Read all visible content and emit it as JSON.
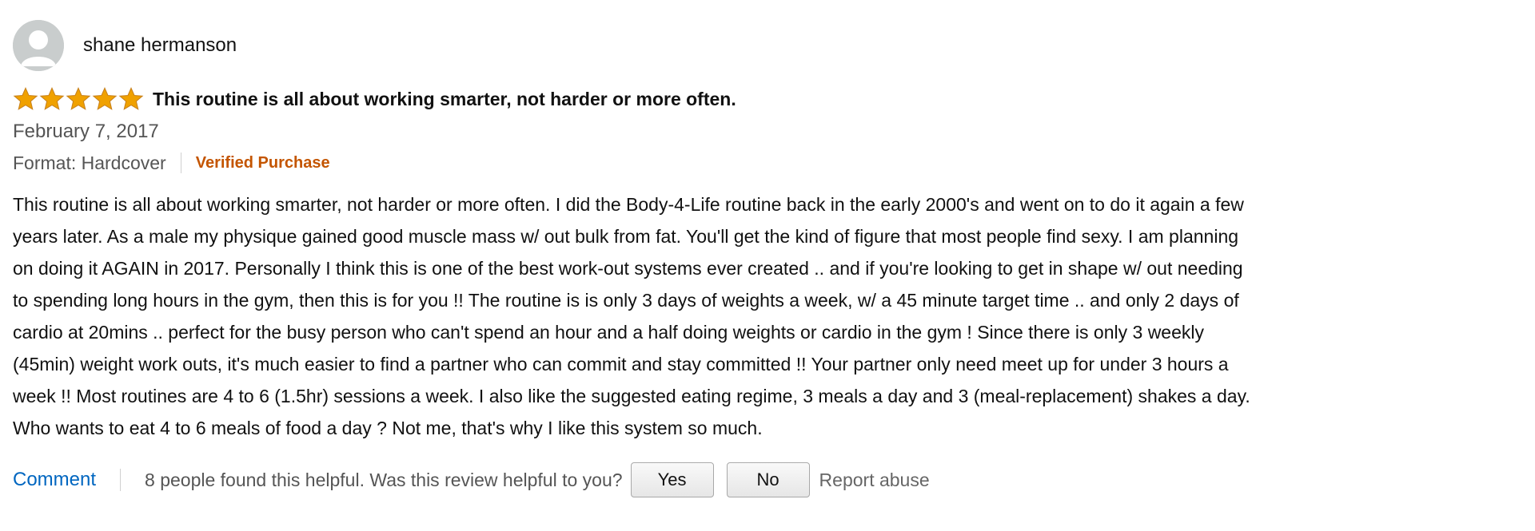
{
  "reviewer": {
    "name": "shane hermanson",
    "avatar_icon": "default-user-avatar-icon"
  },
  "rating": {
    "stars": 5,
    "max_stars": 5,
    "star_color": "#f0a100"
  },
  "review": {
    "title": "This routine is all about working smarter, not harder or more often.",
    "date": "February 7, 2017",
    "format": "Format: Hardcover",
    "verified": "Verified Purchase",
    "body_lines": [
      "This routine is all about working smarter, not harder or more often. I did the Body-4-Life routine back in the early 2000's and went on to do it again a few",
      "years later. As a male my physique gained good muscle mass w/ out bulk from fat. You'll get the kind of figure that most people find sexy. I am planning",
      "on doing it AGAIN in 2017. Personally I think this is one of the best work-out systems ever created .. and if you're looking to get in shape w/ out needing",
      "to spending long hours in the gym, then this is for you !! The routine is is only 3 days of weights a week, w/ a 45 minute target time .. and only 2 days of",
      "cardio at 20mins .. perfect for the busy person who can't spend an hour and a half doing weights or cardio in the gym ! Since there is only 3 weekly",
      "(45min) weight work outs, it's much easier to find a partner who can commit and stay committed !! Your partner only need meet up for under 3 hours a",
      "week !! Most routines are 4 to 6 (1.5hr) sessions a week. I also like the suggested eating regime, 3 meals a day and 3 (meal-replacement) shakes a day.",
      "Who wants to eat 4 to 6 meals of food a day ? Not me, that's why I like this system so much."
    ]
  },
  "footer": {
    "comment_label": "Comment",
    "helpful_text": "8 people found this helpful. Was this review helpful to you?",
    "yes_label": "Yes",
    "no_label": "No",
    "report_label": "Report abuse"
  },
  "colors": {
    "verified": "#c45500",
    "link": "#0066c0",
    "muted": "#555555"
  }
}
